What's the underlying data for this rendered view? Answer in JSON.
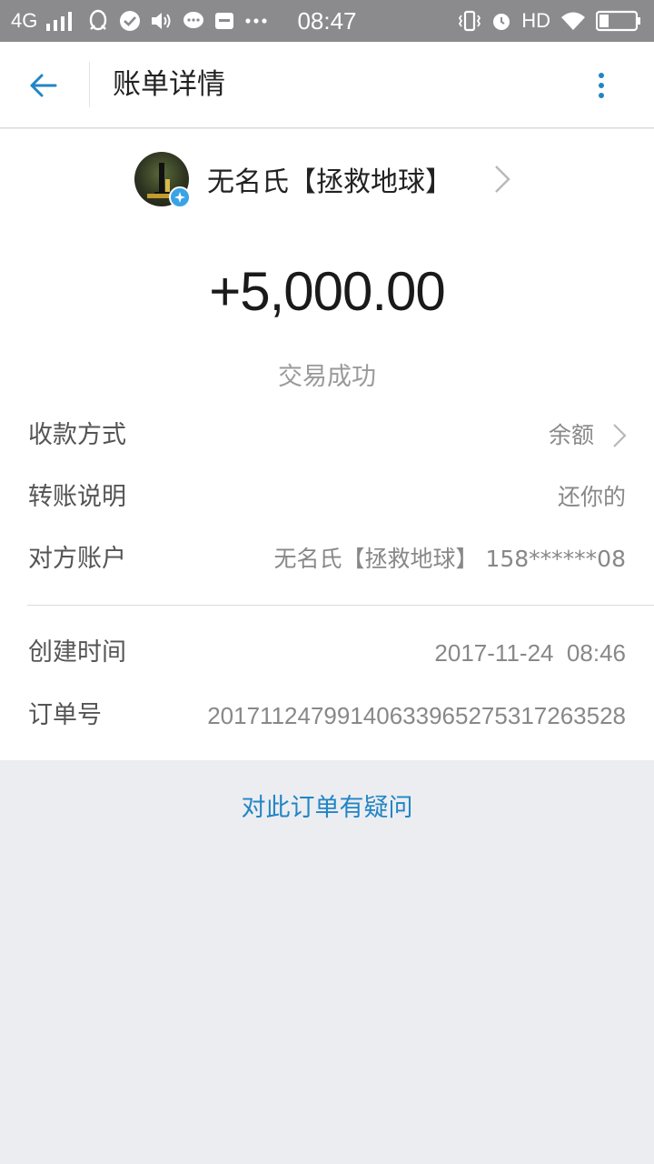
{
  "status_bar": {
    "network": "4G",
    "time": "08:47",
    "hd": "HD"
  },
  "header": {
    "title": "账单详情",
    "back_icon": "back-arrow-icon",
    "more_icon": "more-vertical-icon"
  },
  "payer": {
    "name": "无名氏【拯救地球】"
  },
  "transaction": {
    "amount": "+5,000.00",
    "status": "交易成功"
  },
  "details": [
    {
      "label": "收款方式",
      "value": "余额"
    },
    {
      "label": "转账说明",
      "value": "还你的"
    },
    {
      "label": "对方账户",
      "value": "无名氏【拯救地球】 158******08"
    }
  ],
  "meta": [
    {
      "label": "创建时间",
      "value": "2017-11-24  08:46"
    },
    {
      "label": "订单号",
      "value": "20171124799140633965275317263528"
    }
  ],
  "footer": {
    "question_link": "对此订单有疑问"
  },
  "colors": {
    "accent": "#2185c5",
    "status_bar": "#8b8b8d",
    "background": "#ecedf1"
  }
}
